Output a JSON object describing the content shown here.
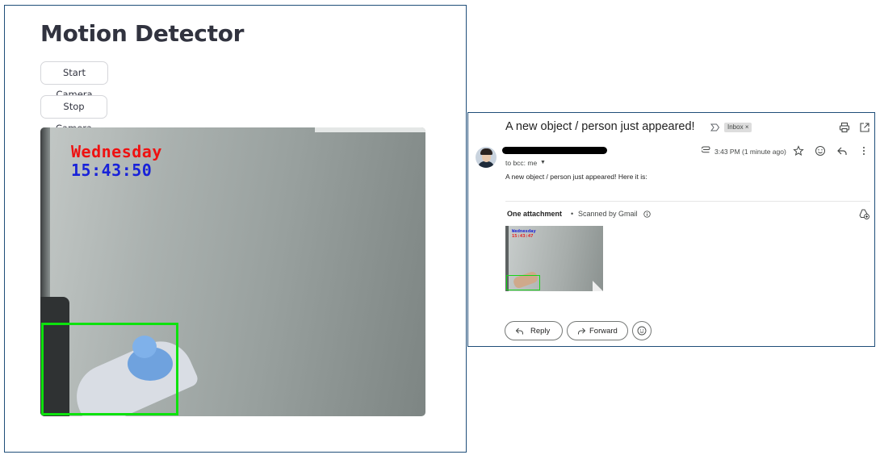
{
  "app": {
    "title": "Motion Detector",
    "start_button": "Start Camera",
    "stop_button": "Stop Camera",
    "camera": {
      "day_stamp": "Wednesday",
      "time_stamp": "15:43:50",
      "day_color": "#ee1111",
      "time_color": "#1822d9",
      "motion_box_color": "#0de20d"
    }
  },
  "email": {
    "subject": "A new object / person just appeared!",
    "label": "Inbox",
    "label_close": "×",
    "to_line": "to bcc: me",
    "received": "3:43 PM (1 minute ago)",
    "body": "A new object / person just appeared! Here it is:",
    "attachments": {
      "title": "One attachment",
      "separator": "•",
      "scanned": "Scanned by Gmail",
      "thumbnail": {
        "day_stamp": "Wednesday",
        "time_stamp": "15:43:47"
      }
    },
    "reply_button": "Reply",
    "forward_button": "Forward",
    "icons": [
      "important-icon",
      "print-icon",
      "open-in-new-window-icon",
      "paperclip-icon",
      "star-icon",
      "emoji-reaction-icon",
      "reply-icon",
      "more-options-icon",
      "info-icon",
      "add-to-drive-icon"
    ]
  }
}
